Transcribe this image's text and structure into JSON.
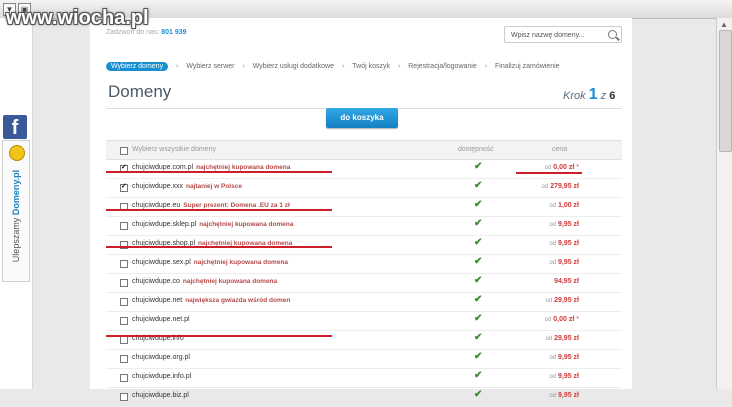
{
  "watermark": "www.wiocha.pl",
  "browser": {
    "back_icon": "back-arrow-icon",
    "home_icon": "home-icon"
  },
  "header": {
    "contact_label": "Zadzwoń do nas:",
    "phone": "801 939",
    "search_placeholder": "Wpisz nazwę domeny..."
  },
  "steps": [
    {
      "label": "Wybierz domeny",
      "active": true
    },
    {
      "label": "Wybierz serwer"
    },
    {
      "label": "Wybierz usługi dodatkowe"
    },
    {
      "label": "Twój koszyk"
    },
    {
      "label": "Rejestracja/logowanie"
    },
    {
      "label": "Finalizuj zamówienie"
    }
  ],
  "page": {
    "title": "Domeny",
    "krok_label": "Krok",
    "krok_current": "1",
    "krok_of": "z",
    "krok_total": "6",
    "cart_button": "do koszyka"
  },
  "table": {
    "header": {
      "select_all": "Wybierz wszystkie domeny",
      "availability": "dostępność",
      "price": "cena"
    },
    "rows": [
      {
        "domain": "chujciwdupe.com.pl",
        "promo": "najchętniej kupowana domena",
        "od": "od",
        "price": "0,00 zł",
        "star": "*",
        "checked": true
      },
      {
        "domain": "chujciwdupe.xxx",
        "promo": "najtaniej w Polsce",
        "od": "od",
        "price": "279,95 zł",
        "checked": true
      },
      {
        "domain": "chujciwdupe.eu",
        "promo": "Super prezent: Domena .EU za 1 zł",
        "od": "od",
        "price": "1,00 zł",
        "checked": false
      },
      {
        "domain": "chujciwdupe.sklep.pl",
        "promo": "najchętniej kupowana domena",
        "od": "od",
        "price": "9,95 zł",
        "checked": false
      },
      {
        "domain": "chujciwdupe.shop.pl",
        "promo": "najchętniej kupowana domena",
        "od": "od",
        "price": "9,95 zł",
        "checked": false
      },
      {
        "domain": "chujciwdupe.sex.pl",
        "promo": "najchętniej kupowana domena",
        "od": "od",
        "price": "9,95 zł",
        "checked": false
      },
      {
        "domain": "chujciwdupe.co",
        "promo": "najchętniej kupowana domena",
        "od": "",
        "price": "94,95 zł",
        "checked": false
      },
      {
        "domain": "chujciwdupe.net",
        "promo": "największa gwiazda wśród domen",
        "od": "od",
        "price": "29,95 zł",
        "checked": false
      },
      {
        "domain": "chujciwdupe.net.pl",
        "promo": "",
        "od": "od",
        "price": "0,00 zł",
        "star": "*",
        "checked": false
      },
      {
        "domain": "chujciwdupe.info",
        "promo": "",
        "od": "od",
        "price": "29,95 zł",
        "checked": false
      },
      {
        "domain": "chujciwdupe.org.pl",
        "promo": "",
        "od": "od",
        "price": "9,95 zł",
        "checked": false
      },
      {
        "domain": "chujciwdupe.info.pl",
        "promo": "",
        "od": "od",
        "price": "9,95 zł",
        "checked": false
      },
      {
        "domain": "chujciwdupe.biz.pl",
        "promo": "",
        "od": "od",
        "price": "9,95 zł",
        "checked": false
      }
    ]
  },
  "sidebar": {
    "facebook_letter": "f",
    "badge_text_plain": "Ulepszamy ",
    "badge_text_brand": "Domeny.pl"
  },
  "colors": {
    "accent": "#1a8fd0",
    "promo": "#b54a4a",
    "price": "#d23a3a",
    "annotation": "#cc1f2a"
  }
}
